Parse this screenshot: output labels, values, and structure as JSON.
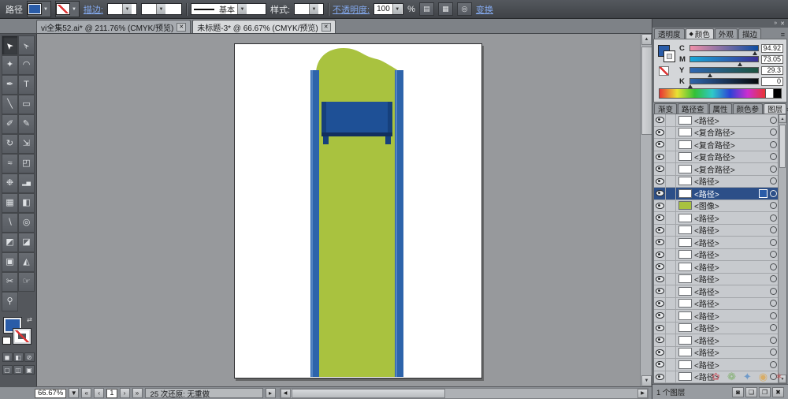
{
  "colors": {
    "fill_swatch": "#2a5ca8"
  },
  "icons": {
    "chevron_down": "▼",
    "up_arrow": "▲",
    "down_arrow": "▼",
    "left_arrow": "◀",
    "right_arrow": "▶",
    "first_page": "«",
    "prev_page": "‹",
    "next_page": "›",
    "last_page": "»",
    "panel_menu": "≡",
    "swap": "⇄",
    "flyout": "▸",
    "dock_collapse": "»",
    "close": "✕",
    "diamond": "◆"
  },
  "top_bar": {
    "context_label": "路径",
    "stroke_label": "描边:",
    "style_label": "样式:",
    "line_style": "基本",
    "opacity_label": "不透明度:",
    "opacity_value": "100",
    "percent_sign": "%",
    "transform_label": "变换"
  },
  "doc_tabs": [
    {
      "label": "vi全集52.ai* @ 211.76% (CMYK/预览)",
      "active": false
    },
    {
      "label": "未标题-3* @ 66.67% (CMYK/预览)",
      "active": true
    }
  ],
  "tools": [
    {
      "name": "selection-tool",
      "glyph": "➤",
      "rot": true,
      "selected": true
    },
    {
      "name": "direct-selection-tool",
      "glyph": "➢",
      "rot": true
    },
    {
      "name": "magic-wand-tool",
      "glyph": "✦"
    },
    {
      "name": "lasso-tool",
      "glyph": "◠"
    },
    {
      "name": "pen-tool",
      "glyph": "✒"
    },
    {
      "name": "type-tool",
      "glyph": "T"
    },
    {
      "name": "line-segment-tool",
      "glyph": "╲"
    },
    {
      "name": "rectangle-tool",
      "glyph": "▭"
    },
    {
      "name": "paintbrush-tool",
      "glyph": "✐"
    },
    {
      "name": "pencil-tool",
      "glyph": "✎"
    },
    {
      "name": "rotate-tool",
      "glyph": "↻"
    },
    {
      "name": "scale-tool",
      "glyph": "⇲"
    },
    {
      "name": "warp-tool",
      "glyph": "≈"
    },
    {
      "name": "free-transform-tool",
      "glyph": "◰"
    },
    {
      "name": "symbol-sprayer-tool",
      "glyph": "❉"
    },
    {
      "name": "column-graph-tool",
      "glyph": "▂▅",
      "small": true
    },
    {
      "name": "mesh-tool",
      "glyph": "▦"
    },
    {
      "name": "gradient-tool",
      "glyph": "◧"
    },
    {
      "name": "eyedropper-tool",
      "glyph": "∖"
    },
    {
      "name": "blend-tool",
      "glyph": "◎"
    },
    {
      "name": "live-paint-bucket-tool",
      "glyph": "◩"
    },
    {
      "name": "live-paint-selection-tool",
      "glyph": "◪"
    },
    {
      "name": "crop-area-tool",
      "glyph": "▣"
    },
    {
      "name": "slice-tool",
      "glyph": "◭"
    },
    {
      "name": "scissors-tool",
      "glyph": "✂"
    },
    {
      "name": "hand-tool",
      "glyph": "☞"
    },
    {
      "name": "zoom-tool",
      "glyph": "⚲"
    }
  ],
  "toolbox": {
    "paint_buttons": [
      {
        "name": "color-button",
        "glyph": "◼"
      },
      {
        "name": "gradient-button",
        "glyph": "◧"
      },
      {
        "name": "none-button",
        "glyph": "⊘"
      }
    ],
    "screen_modes": [
      {
        "name": "standard-screen-mode-button",
        "glyph": "▢"
      },
      {
        "name": "fullscreen-menu-mode-button",
        "glyph": "◫"
      },
      {
        "name": "fullscreen-mode-button",
        "glyph": "▣"
      }
    ]
  },
  "color_panel": {
    "tabs": [
      {
        "name": "tab-transparency",
        "label": "透明度"
      },
      {
        "name": "tab-color",
        "label": "颜色",
        "active": true,
        "icon": "◆"
      },
      {
        "name": "tab-appearance",
        "label": "外观"
      },
      {
        "name": "tab-stroke",
        "label": "描边"
      }
    ],
    "sliders": [
      {
        "channel": "C",
        "value": "94.92",
        "pct": 94.92,
        "grad": "g-c"
      },
      {
        "channel": "M",
        "value": "73.05",
        "pct": 73.05,
        "grad": "g-m"
      },
      {
        "channel": "Y",
        "value": "29.3",
        "pct": 29.3,
        "grad": "g-y"
      },
      {
        "channel": "K",
        "value": "0",
        "pct": 0,
        "grad": "g-k"
      }
    ]
  },
  "layers_panel": {
    "tabs": [
      {
        "name": "tab-gradient",
        "label": "渐变"
      },
      {
        "name": "tab-pathfinder",
        "label": "路径查"
      },
      {
        "name": "tab-attributes",
        "label": "属性"
      },
      {
        "name": "tab-color-guide",
        "label": "颜色参"
      },
      {
        "name": "tab-layers",
        "label": "图层",
        "active": true
      }
    ],
    "rows": [
      {
        "label": "<路径>"
      },
      {
        "label": "<复合路径>"
      },
      {
        "label": "<复合路径>"
      },
      {
        "label": "<复合路径>"
      },
      {
        "label": "<复合路径>"
      },
      {
        "label": "<路径>"
      },
      {
        "label": "<路径>",
        "selected": true
      },
      {
        "label": "<图像>",
        "thumb": "#a9c23f"
      },
      {
        "label": "<路径>"
      },
      {
        "label": "<路径>"
      },
      {
        "label": "<路径>"
      },
      {
        "label": "<路径>"
      },
      {
        "label": "<路径>"
      },
      {
        "label": "<路径>"
      },
      {
        "label": "<路径>"
      },
      {
        "label": "<路径>"
      },
      {
        "label": "<路径>"
      },
      {
        "label": "<路径>"
      },
      {
        "label": "<路径>"
      },
      {
        "label": "<路径>"
      },
      {
        "label": "<路径>"
      },
      {
        "label": "<路径>"
      }
    ],
    "footer_count": "1 个图层",
    "footer_buttons": [
      {
        "name": "make-clip-mask-button",
        "glyph": "◙"
      },
      {
        "name": "new-sublayer-button",
        "glyph": "❏"
      },
      {
        "name": "new-layer-button",
        "glyph": "❐"
      },
      {
        "name": "delete-layer-button",
        "glyph": "✖"
      }
    ]
  },
  "status_bar": {
    "zoom": "66.67%",
    "page": "1",
    "undo_status": "25 次还原: 无重做"
  },
  "artwork": {
    "green": "#a9c23f",
    "strip": "#2e64ab",
    "strip_light": "#5585c4",
    "band": "#1e5096",
    "band_dark": "#16407c",
    "band_edge": "#122f5e"
  },
  "watermark": [
    {
      "glyph": "✿",
      "color": "#cf5f6a"
    },
    {
      "glyph": "❁",
      "color": "#69a74e"
    },
    {
      "glyph": "✦",
      "color": "#4a86c8"
    },
    {
      "glyph": "◉",
      "color": "#e0a23c"
    },
    {
      "glyph": "✶",
      "color": "#bf4f4f"
    }
  ]
}
